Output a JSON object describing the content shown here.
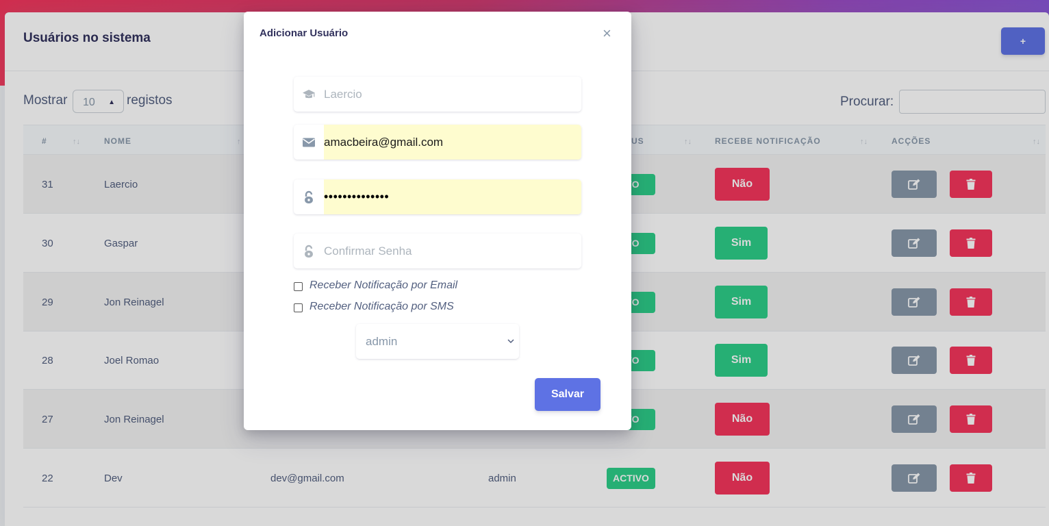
{
  "page": {
    "card_title": "Usuários no sistema",
    "add_button": "+",
    "length": {
      "prefix": "Mostrar",
      "value": "10",
      "suffix": "registos"
    },
    "search": {
      "label": "Procurar:",
      "value": ""
    }
  },
  "table": {
    "headers": [
      "#",
      "NOME",
      "US",
      "RECEBE NOTIFICAÇÃO",
      "ACÇÕES"
    ],
    "rows": [
      {
        "id": "31",
        "name": "Laercio",
        "email": "",
        "role": "",
        "status": "IVO",
        "notify": "Não"
      },
      {
        "id": "30",
        "name": "Gaspar",
        "email": "",
        "role": "",
        "status": "IVO",
        "notify": "Sim"
      },
      {
        "id": "29",
        "name": "Jon Reinagel",
        "email": "",
        "role": "",
        "status": "IVO",
        "notify": "Sim"
      },
      {
        "id": "28",
        "name": "Joel Romao",
        "email": "",
        "role": "",
        "status": "IVO",
        "notify": "Sim"
      },
      {
        "id": "27",
        "name": "Jon Reinagel",
        "email": "",
        "role": "",
        "status": "IVO",
        "notify": "Não"
      },
      {
        "id": "22",
        "name": "Dev",
        "email": "dev@gmail.com",
        "role": "admin",
        "status": "ACTIVO",
        "notify": "Não"
      }
    ]
  },
  "modal": {
    "title": "Adicionar Usuário",
    "close": "×",
    "name_value": "Laercio",
    "email_value": "amacbeira@gmail.com",
    "password_value": "••••••••••••••",
    "confirm_placeholder": "Confirmar Senha",
    "checkbox_email": "Receber Notificação por Email",
    "checkbox_sms": "Receber Notificação por SMS",
    "role_value": "admin",
    "save": "Salvar"
  },
  "colors": {
    "primary": "#5e72e4",
    "success": "#2dce89",
    "danger": "#f5365c",
    "secondary": "#8898aa",
    "autofill": "#fefccf"
  },
  "icons": {
    "name": "graduation-cap-icon",
    "email": "envelope-icon",
    "password": "unlock-icon",
    "confirm": "unlock-icon",
    "edit": "edit-icon",
    "delete": "trash-icon"
  }
}
